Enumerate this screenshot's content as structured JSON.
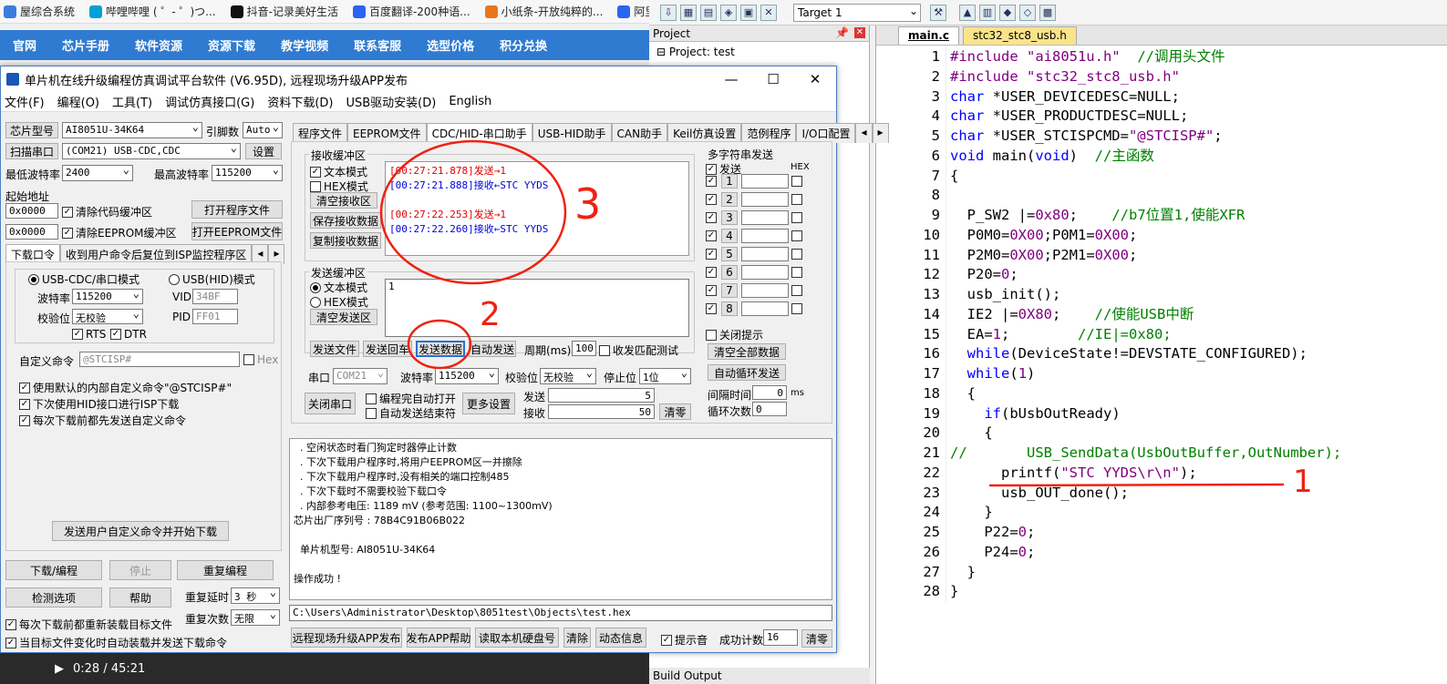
{
  "browser": {
    "bookmarks": [
      {
        "label": "屋综合系统",
        "icon": "site-icon",
        "color": "#3b7ddd"
      },
      {
        "label": "哔哩哔哩 ( ゜- ゜)つ...",
        "icon": "bilibili-icon",
        "color": "#00a1d6"
      },
      {
        "label": "抖音-记录美好生活",
        "icon": "douyin-icon",
        "color": "#111111"
      },
      {
        "label": "百度翻译-200种语...",
        "icon": "baidu-translate-icon",
        "color": "#2b63f2"
      },
      {
        "label": "小纸条-开放纯粹的...",
        "icon": "fox-icon",
        "color": "#e8761d"
      },
      {
        "label": "阿里",
        "icon": "search-icon",
        "color": "#2b63f2"
      }
    ],
    "nav": [
      "官网",
      "芯片手册",
      "软件资源",
      "资源下载",
      "教学视频",
      "联系客服",
      "选型价格",
      "积分兑换"
    ]
  },
  "keil": {
    "target": "Target 1",
    "project_title": "Project",
    "project_root": "Project: test",
    "build_output": "Build Output",
    "tabs": [
      "main.c",
      "stc32_stc8_usb.h"
    ],
    "code": [
      {
        "n": "1",
        "html": "<span class='st'>#include \"ai8051u.h\"</span>  <span class='cm'>//调用头文件</span>"
      },
      {
        "n": "2",
        "html": "<span class='st'>#include \"stc32_stc8_usb.h\"</span>"
      },
      {
        "n": "3",
        "html": "<span class='kw'>char</span> *USER_DEVICEDESC=NULL;"
      },
      {
        "n": "4",
        "html": "<span class='kw'>char</span> *USER_PRODUCTDESC=NULL;"
      },
      {
        "n": "5",
        "html": "<span class='kw'>char</span> *USER_STCISPCMD=<span class='st'>\"@STCISP#\"</span>;"
      },
      {
        "n": "6",
        "html": "<span class='kw'>void</span> main(<span class='kw'>void</span>)  <span class='cm'>//主函数</span>"
      },
      {
        "n": "7",
        "html": "{"
      },
      {
        "n": "8",
        "html": ""
      },
      {
        "n": "9",
        "html": "  P_SW2 |=<span class='nm'>0x80</span>;    <span class='cm'>//b7位置1,使能XFR</span>"
      },
      {
        "n": "10",
        "html": "  P0M0=<span class='nm'>0X00</span>;P0M1=<span class='nm'>0X00</span>;"
      },
      {
        "n": "11",
        "html": "  P2M0=<span class='nm'>0X00</span>;P2M1=<span class='nm'>0X00</span>;"
      },
      {
        "n": "12",
        "html": "  P20=<span class='nm'>0</span>;"
      },
      {
        "n": "13",
        "html": "  usb_init();"
      },
      {
        "n": "14",
        "html": "  IE2 |=<span class='nm'>0X80</span>;    <span class='cm'>//使能USB中断</span>"
      },
      {
        "n": "15",
        "html": "  EA=<span class='nm'>1</span>;        <span class='cm'>//IE|=0x80;</span>"
      },
      {
        "n": "16",
        "html": "  <span class='kw'>while</span>(DeviceState!=DEVSTATE_CONFIGURED);"
      },
      {
        "n": "17",
        "html": "  <span class='kw'>while</span>(<span class='nm'>1</span>)"
      },
      {
        "n": "18",
        "html": "  {"
      },
      {
        "n": "19",
        "html": "    <span class='kw'>if</span>(bUsbOutReady)"
      },
      {
        "n": "20",
        "html": "    {"
      },
      {
        "n": "21",
        "html": "<span class='cm'>//       USB_SendData(UsbOutBuffer,OutNumber);</span>"
      },
      {
        "n": "22",
        "html": "      printf(<span class='st'>\"STC YYDS\\r\\n\"</span>);"
      },
      {
        "n": "23",
        "html": "      usb_OUT_done();"
      },
      {
        "n": "24",
        "html": "    }"
      },
      {
        "n": "25",
        "html": "    P22=<span class='nm'>0</span>;"
      },
      {
        "n": "26",
        "html": "    P24=<span class='nm'>0</span>;"
      },
      {
        "n": "27",
        "html": "  }"
      },
      {
        "n": "28",
        "html": "}"
      }
    ]
  },
  "isp": {
    "title": "单片机在线升级编程仿真调试平台软件 (V6.95D), 远程现场升级APP发布",
    "menu": [
      "文件(F)",
      "编程(O)",
      "工具(T)",
      "调试仿真接口(G)",
      "资料下载(D)",
      "USB驱动安装(D)",
      "English"
    ],
    "chip_label": "芯片型号",
    "chip": "AI8051U-34K64",
    "pins_label": "引脚数",
    "pins": "Auto",
    "scan_btn": "扫描串口",
    "port": "(COM21) USB-CDC,CDC",
    "settings_btn": "设置",
    "min_baud_label": "最低波特率",
    "min_baud": "2400",
    "max_baud_label": "最高波特率",
    "max_baud": "115200",
    "start_addr_label": "起始地址",
    "addr1": "0x0000",
    "addr2": "0x0000",
    "clear_code": "清除代码缓冲区",
    "clear_eeprom": "清除EEPROM缓冲区",
    "open_prog": "打开程序文件",
    "open_eeprom": "打开EEPROM文件",
    "dl_tabs": [
      "下载口令",
      "收到用户命令后复位到ISP监控程序区"
    ],
    "mode_cdc": "USB-CDC/串口模式",
    "mode_hid": "USB(HID)模式",
    "baud_label": "波特率",
    "baud": "115200",
    "parity_label": "校验位",
    "parity": "无校验",
    "rts": "RTS",
    "dtr": "DTR",
    "vid_label": "VID",
    "vid": "34BF",
    "pid_label": "PID",
    "pid": "FF01",
    "custom_cmd_label": "自定义命令",
    "custom_cmd": "@STCISP#",
    "hex_label": "Hex",
    "opt1": "使用默认的内部自定义命令\"@STCISP#\"",
    "opt2": "下次使用HID接口进行ISP下载",
    "opt3": "每次下载前都先发送自定义命令",
    "send_custom_btn": "发送用户自定义命令并开始下载",
    "download_btn": "下载/编程",
    "stop_btn": "停止",
    "reprog_btn": "重复编程",
    "detect_btn": "检测选项",
    "help_btn": "帮助",
    "delay_label": "重复延时",
    "delay": "3 秒",
    "count_label": "重复次数",
    "count": "无限",
    "reload_opt": "每次下载前都重新装载目标文件",
    "auto_opt": "当目标文件变化时自动装载并发送下载命令",
    "main_tabs": [
      "程序文件",
      "EEPROM文件",
      "CDC/HID-串口助手",
      "USB-HID助手",
      "CAN助手",
      "Keil仿真设置",
      "范例程序",
      "I/O口配置"
    ],
    "recv_label": "接收缓冲区",
    "text_mode": "文本模式",
    "hex_mode": "HEX模式",
    "clear_recv": "清空接收区",
    "save_recv": "保存接收数据",
    "copy_recv": "复制接收数据",
    "recv_lines": [
      {
        "cls": "rs",
        "text": "[00:27:21.878]发送→1"
      },
      {
        "cls": "rr",
        "text": "[00:27:21.888]接收←STC YYDS"
      },
      {
        "cls": "rs",
        "text": ""
      },
      {
        "cls": "rs",
        "text": "[00:27:22.253]发送→1"
      },
      {
        "cls": "rr",
        "text": "[00:27:22.260]接收←STC YYDS"
      }
    ],
    "send_label": "发送缓冲区",
    "send_text": "1",
    "clear_send": "清空发送区",
    "send_file": "发送文件",
    "send_cr": "发送回车",
    "send_data": "发送数据",
    "auto_send": "自动发送",
    "period_label": "周期(ms)",
    "period": "100",
    "loop_test": "收发匹配测试",
    "port_label": "串口",
    "port_val": "COM21",
    "baud2_label": "波特率",
    "baud2": "115200",
    "parity2_label": "校验位",
    "parity2": "无校验",
    "stop_label": "停止位",
    "stop": "1位",
    "close_port": "关闭串口",
    "auto_open": "编程完自动打开",
    "auto_end": "自动发送结束符",
    "more_settings": "更多设置",
    "sent_label": "发送",
    "sent": "5",
    "recvd_label": "接收",
    "recvd": "50",
    "clear_cnt": "清零",
    "multi_label": "多字符串发送",
    "multi_send": "发送",
    "multi_hex": "HEX",
    "multi_rows": [
      "1",
      "2",
      "3",
      "4",
      "5",
      "6",
      "7",
      "8"
    ],
    "close_tip": "关闭提示",
    "clear_all": "清空全部数据",
    "auto_loop": "自动循环发送",
    "interval_label": "间隔时间",
    "interval": "0",
    "interval_unit": "ms",
    "loop_label": "循环次数",
    "loop": "0",
    "log": "  . 空闲状态时看门狗定时器停止计数\n  . 下次下载用户程序时,将用户EEPROM区一并擦除\n  . 下次下载用户程序时,没有相关的端口控制485\n  . 下次下载时不需要校验下载口令\n  . 内部参考电压: 1189 mV (参考范围: 1100~1300mV)\n芯片出厂序列号 : 78B4C91B06B022\n\n  单片机型号: AI8051U-34K64\n\n操作成功 !",
    "path": "C:\\Users\\Administrator\\Desktop\\8051test\\Objects\\test.hex",
    "bottom_btns": [
      "远程现场升级APP发布",
      "发布APP帮助",
      "读取本机硬盘号",
      "清除",
      "动态信息"
    ],
    "beep": "提示音",
    "success_label": "成功计数",
    "success": "16",
    "clear_btn": "清零"
  },
  "annotations": [
    "3",
    "2",
    "1"
  ],
  "video": {
    "time": "0:28 / 45:21"
  }
}
